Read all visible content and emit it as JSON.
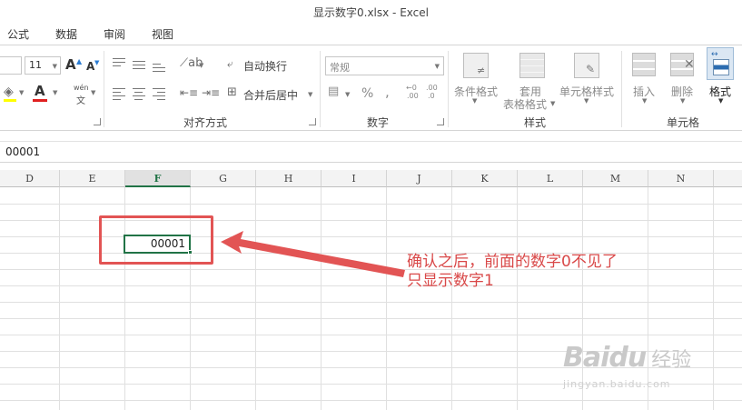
{
  "window": {
    "title": "显示数字0.xlsx - Excel"
  },
  "tabs": [
    {
      "label": "公式"
    },
    {
      "label": "数据"
    },
    {
      "label": "审阅"
    },
    {
      "label": "视图"
    }
  ],
  "ribbon": {
    "font": {
      "size": "11",
      "grow": "A",
      "shrink": "A",
      "phonetic_top": "wén",
      "phonetic_bottom": "文"
    },
    "alignment": {
      "wrap_text": "自动换行",
      "merge_center": "合并后居中",
      "group_label": "对齐方式"
    },
    "number": {
      "format": "常规",
      "percent": "%",
      "comma": ",",
      "inc_decimal": ".00",
      "dec_decimal": ".0",
      "group_label": "数字"
    },
    "styles": {
      "conditional": "条件格式",
      "table_line1": "套用",
      "table_line2": "表格格式",
      "cell_styles": "单元格样式",
      "group_label": "样式"
    },
    "cells": {
      "insert": "插入",
      "delete": "删除",
      "format": "格式",
      "group_label": "单元格"
    }
  },
  "formula_bar": {
    "value": "00001"
  },
  "grid": {
    "columns": [
      "D",
      "E",
      "F",
      "G",
      "H",
      "I",
      "J",
      "K",
      "L",
      "M",
      "N"
    ],
    "active_column": "F",
    "selected_cell_value": "00001"
  },
  "annotation": {
    "line1": "确认之后，前面的数字0不见了",
    "line2": "只显示数字1",
    "color": "#d94848"
  },
  "watermark": {
    "brand": "Bai",
    "brand_du": "du",
    "brand_cn": "经验",
    "url": "jingyan.baidu.com"
  },
  "colors": {
    "excel_green": "#217346",
    "annotation_red": "#e25454"
  }
}
